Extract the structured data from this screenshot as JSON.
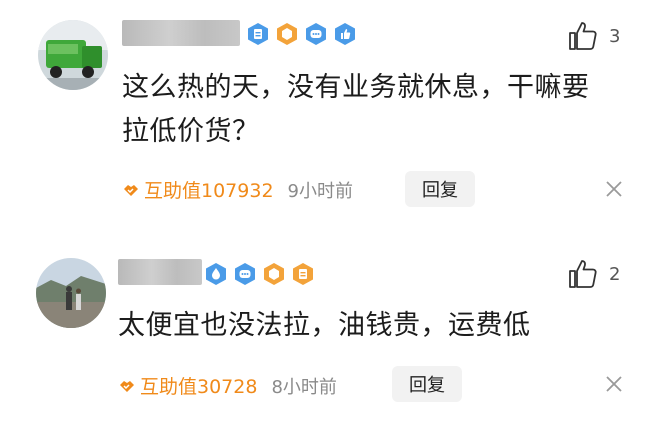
{
  "comments": [
    {
      "text_lines": [
        "这么热的天，没有业务就休息，干嘛要",
        "拉低价货？"
      ],
      "likes": "3",
      "help_label": "互助值107932",
      "time": "9小时前",
      "reply_label": "回复",
      "badges": [
        "doc-badge-icon",
        "cube-badge-icon",
        "chat-badge-icon",
        "thumb-badge-icon"
      ]
    },
    {
      "text_lines": [
        "太便宜也没法拉，油钱贵，运费低"
      ],
      "likes": "2",
      "help_label": "互助值30728",
      "time": "8小时前",
      "reply_label": "回复",
      "badges": [
        "drop-badge-icon",
        "chat-badge-icon",
        "cube-badge-icon",
        "doc-badge-icon"
      ]
    }
  ],
  "colors": {
    "accent": "#f08a1a",
    "badge_blue": "#4a9be8",
    "badge_orange": "#f3a33a"
  }
}
